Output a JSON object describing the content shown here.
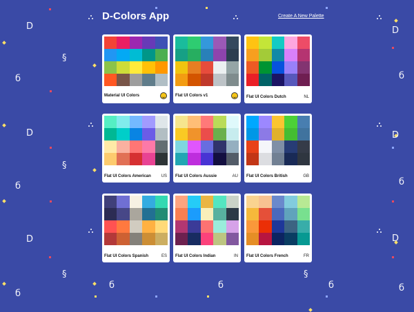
{
  "app": {
    "title": "D-Colors App",
    "create_link": "Create A New Palette",
    "background": "#3a4aa6"
  },
  "palettes": [
    {
      "name": "Material UI Colors",
      "emoji": "earth-emoji",
      "colors": [
        "#f44336",
        "#e91e63",
        "#9c27b0",
        "#673ab7",
        "#3f51b5",
        "#2196f3",
        "#03a9f4",
        "#00bcd4",
        "#009688",
        "#4caf50",
        "#8bc34a",
        "#cddc39",
        "#ffeb3b",
        "#ffc107",
        "#ff9800",
        "#ff5722",
        "#795548",
        "#9e9e9e",
        "#607d8b",
        "#b0bec5"
      ]
    },
    {
      "name": "Flat UI Colors v1",
      "emoji": "hand-emoji",
      "colors": [
        "#1abc9c",
        "#2ecc71",
        "#3498db",
        "#9b59b6",
        "#34495e",
        "#16a085",
        "#27ae60",
        "#2980b9",
        "#8e44ad",
        "#2c3e50",
        "#f1c40f",
        "#e67e22",
        "#e74c3c",
        "#ecf0f1",
        "#95a5a6",
        "#f39c12",
        "#d35400",
        "#c0392b",
        "#bdc3c7",
        "#7f8c8d"
      ]
    },
    {
      "name": "Flat UI Colors Dutch",
      "emoji": "NL",
      "colors": [
        "#ffc312",
        "#c4e538",
        "#12cbc4",
        "#fda7df",
        "#ed4c67",
        "#f79f1f",
        "#a3cb38",
        "#1289a7",
        "#d980fa",
        "#b53471",
        "#ee5a24",
        "#009432",
        "#0652dd",
        "#9980fa",
        "#833471",
        "#ea2027",
        "#006266",
        "#1b1464",
        "#5758bb",
        "#6f1e51"
      ]
    },
    {
      "name": "Flat UI Colors American",
      "emoji": "US",
      "colors": [
        "#55efc4",
        "#81ecec",
        "#74b9ff",
        "#a29bfe",
        "#dfe6e9",
        "#00b894",
        "#00cec9",
        "#0984e3",
        "#6c5ce7",
        "#b2bec3",
        "#ffeaa7",
        "#fab1a0",
        "#ff7675",
        "#fd79a8",
        "#636e72",
        "#fdcb6e",
        "#e17055",
        "#d63031",
        "#e84393",
        "#2d3436"
      ]
    },
    {
      "name": "Flat UI Colors Aussie",
      "emoji": "AU",
      "colors": [
        "#f6e58d",
        "#ffbe76",
        "#ff7979",
        "#badc58",
        "#dff9fb",
        "#f9ca24",
        "#f0932b",
        "#eb4d4b",
        "#6ab04c",
        "#c7ecee",
        "#7ed6df",
        "#e056fd",
        "#686de0",
        "#30336b",
        "#95afc0",
        "#22a6b3",
        "#be2edd",
        "#4834d4",
        "#130f40",
        "#535c68"
      ]
    },
    {
      "name": "Flat UI Colors British",
      "emoji": "GB",
      "colors": [
        "#00a8ff",
        "#9c88ff",
        "#fbc531",
        "#4cd137",
        "#487eb0",
        "#0097e6",
        "#8c7ae6",
        "#e1b12c",
        "#44bd32",
        "#40739e",
        "#e84118",
        "#f5f6fa",
        "#7f8fa6",
        "#273c75",
        "#353b48",
        "#c23616",
        "#dcdde1",
        "#718093",
        "#192a56",
        "#2f3640"
      ]
    },
    {
      "name": "Flat UI Colors Spanish",
      "emoji": "ES",
      "colors": [
        "#40407a",
        "#706fd3",
        "#f7f1e3",
        "#34ace0",
        "#33d9b2",
        "#2c2c54",
        "#474787",
        "#aaa69d",
        "#227093",
        "#218c74",
        "#ff5252",
        "#ff793f",
        "#d1ccc0",
        "#ffb142",
        "#ffda79",
        "#b33939",
        "#cd6133",
        "#84817a",
        "#cc8e35",
        "#ccae62"
      ]
    },
    {
      "name": "Flat UI Colors Indian",
      "emoji": "IN",
      "colors": [
        "#fea47f",
        "#25ccf7",
        "#eab543",
        "#55e6c1",
        "#cad3c8",
        "#f97f51",
        "#1b9cfc",
        "#f8efba",
        "#58b19f",
        "#2c3a47",
        "#b33771",
        "#3b3b98",
        "#fd7272",
        "#9aecdb",
        "#d6a2e8",
        "#6d214f",
        "#182c61",
        "#fc427b",
        "#bdc581",
        "#82589f"
      ]
    },
    {
      "name": "Flat UI Colors French",
      "emoji": "FR",
      "colors": [
        "#fad390",
        "#f8c291",
        "#6a89cc",
        "#82ccdd",
        "#b8e994",
        "#f6b93b",
        "#e55039",
        "#4a69bd",
        "#60a3bc",
        "#78e08f",
        "#fa983a",
        "#eb2f06",
        "#1e3799",
        "#3c6382",
        "#38ada9",
        "#e58e26",
        "#b71540",
        "#0c2461",
        "#0a3d62",
        "#079992"
      ]
    }
  ]
}
